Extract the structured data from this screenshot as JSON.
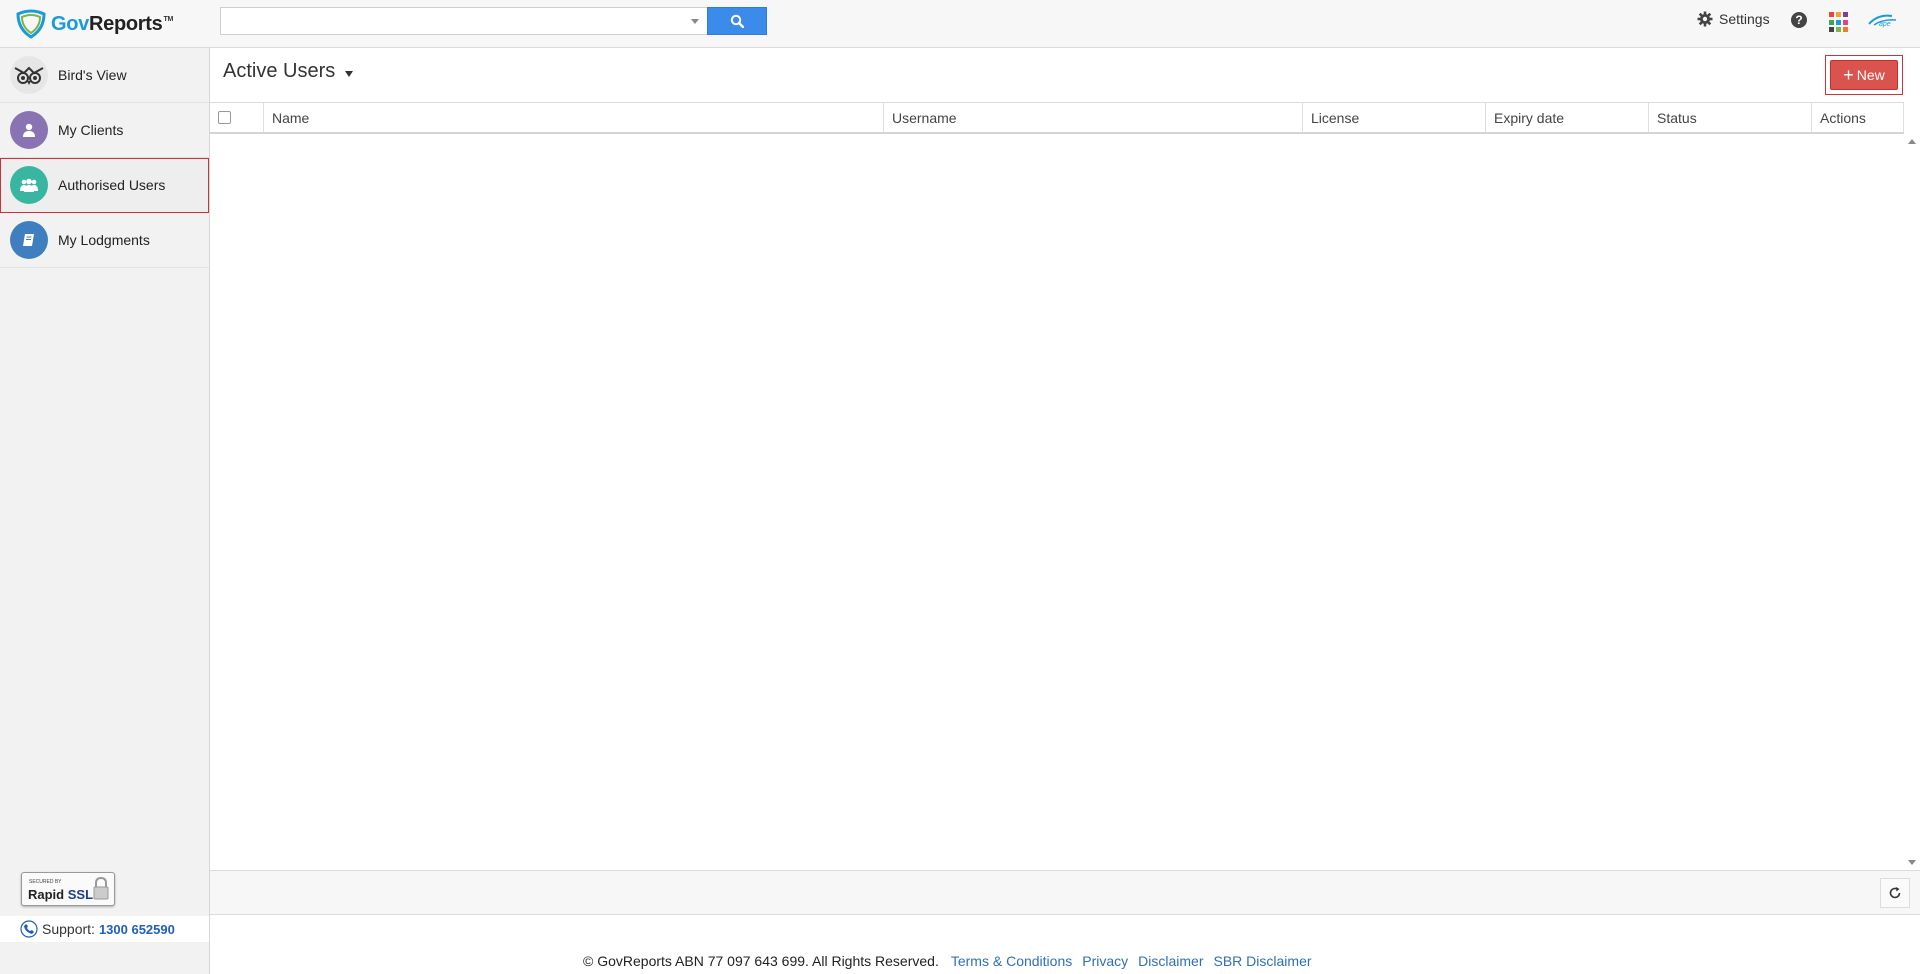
{
  "header": {
    "logo": {
      "gov": "Gov",
      "reports": "Reports",
      "tm": "TM"
    },
    "search": {
      "value": "",
      "placeholder": ""
    },
    "settings_label": "Settings",
    "help_label": "?",
    "app_tiles": [
      "#e8483a",
      "#f2a52b",
      "#7b3f98",
      "#3aa757",
      "#1b9bd7",
      "#e0457b",
      "#444444",
      "#7ab648",
      "#f07c2a"
    ]
  },
  "sidebar": {
    "items": [
      {
        "label": "Bird's View",
        "icon": "owl-icon",
        "color": "#e6e6e6"
      },
      {
        "label": "My Clients",
        "icon": "user-icon",
        "color": "#8a73b3"
      },
      {
        "label": "Authorised Users",
        "icon": "users-icon",
        "color": "#3ab5a1",
        "active": true
      },
      {
        "label": "My Lodgments",
        "icon": "book-icon",
        "color": "#3f7fbf"
      }
    ],
    "ssl": {
      "line1": "SECURED BY",
      "rapid": "Rapid",
      "ssl": "SSL"
    },
    "support": {
      "label": "Support:",
      "number": "1300 652590"
    }
  },
  "main": {
    "title": "Active Users",
    "new_label": "New",
    "columns": [
      "Name",
      "Username",
      "License",
      "Expiry date",
      "Status",
      "Actions"
    ],
    "rows": []
  },
  "footer": {
    "copyright": "© GovReports ABN 77 097 643 699. All Rights Reserved.",
    "links": [
      "Terms & Conditions",
      "Privacy",
      "Disclaimer",
      "SBR Disclaimer"
    ]
  },
  "colors": {
    "accent_blue": "#3b8beb",
    "danger": "#d9534f",
    "link": "#2f6fb8"
  }
}
